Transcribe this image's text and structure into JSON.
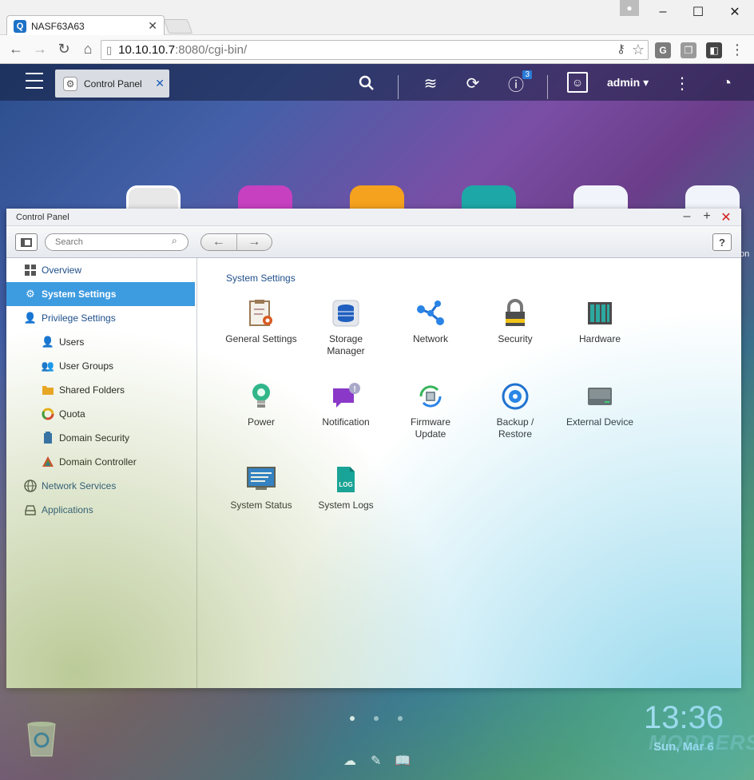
{
  "browser": {
    "tab_title": "NASF63A63",
    "url_host": "10.10.10.7",
    "url_rest": ":8080/cgi-bin/",
    "ext_g": "G"
  },
  "qts": {
    "tab_label": "Control Panel",
    "notification_count": "3",
    "user": "admin"
  },
  "window": {
    "title": "Control Panel",
    "search_placeholder": "Search",
    "help": "?"
  },
  "sidebar": {
    "items": [
      {
        "label": "Overview",
        "icon": "overview-icon"
      },
      {
        "label": "System Settings",
        "icon": "gear-icon"
      },
      {
        "label": "Privilege Settings",
        "icon": "user-icon"
      },
      {
        "label": "Users",
        "icon": "user-icon"
      },
      {
        "label": "User Groups",
        "icon": "user-group-icon"
      },
      {
        "label": "Shared Folders",
        "icon": "folder-icon"
      },
      {
        "label": "Quota",
        "icon": "quota-icon"
      },
      {
        "label": "Domain Security",
        "icon": "domain-security-icon"
      },
      {
        "label": "Domain Controller",
        "icon": "domain-controller-icon"
      },
      {
        "label": "Network Services",
        "icon": "globe-icon"
      },
      {
        "label": "Applications",
        "icon": "applications-icon"
      }
    ]
  },
  "main": {
    "section_title": "System Settings",
    "items": [
      {
        "line1": "General Settings",
        "line2": ""
      },
      {
        "line1": "Storage",
        "line2": "Manager"
      },
      {
        "line1": "Network",
        "line2": ""
      },
      {
        "line1": "Security",
        "line2": ""
      },
      {
        "line1": "Hardware",
        "line2": ""
      },
      {
        "line1": "Power",
        "line2": ""
      },
      {
        "line1": "Notification",
        "line2": ""
      },
      {
        "line1": "Firmware",
        "line2": "Update"
      },
      {
        "line1": "Backup /",
        "line2": "Restore"
      },
      {
        "line1": "External Device",
        "line2": ""
      },
      {
        "line1": "System Status",
        "line2": ""
      },
      {
        "line1": "System Logs",
        "line2": ""
      }
    ]
  },
  "desktop": {
    "time": "13:36",
    "date": "Sun, Mar 6",
    "watermark": "MODDERS",
    "edge_label": "on"
  }
}
